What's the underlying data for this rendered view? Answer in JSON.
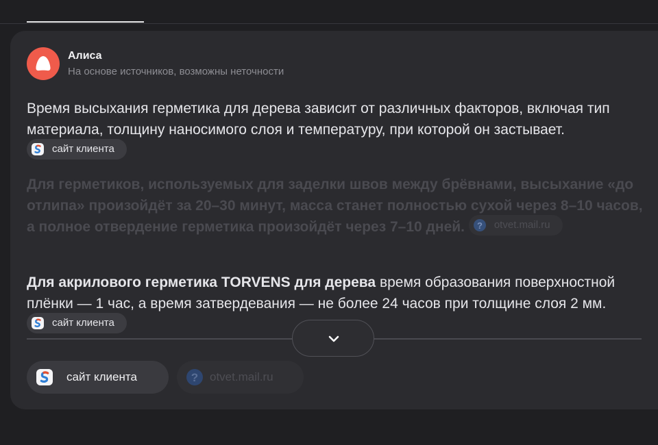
{
  "header": {
    "author": "Алиса",
    "disclaimer": "На основе источников, возможны неточности"
  },
  "answer": {
    "p1": "Время высыхания герметика для дерева зависит от различных факторов, включая тип материала, толщину наносимого слоя и температуру, при которой он застывает.",
    "p1_chip": "сайт клиента",
    "p2": "Для герметиков, используемых для заделки швов между брёвнами, высыхание «до отлипа» произойдёт за 20–30 минут, масса станет полностью сухой через 8–10 часов, а полное отвердение герметика произойдёт через 7–10 дней.",
    "p2_chip": "otvet.mail.ru",
    "p3_bold": "Для акрилового герметика TORVENS для дерева",
    "p3_rest": " время образования поверхностной плёнки — 1 час, а время затвердевания — не более 24 часов при толщине слоя 2 мм.",
    "p3_chip": "сайт клиента"
  },
  "sources": [
    {
      "label": "сайт клиента",
      "icon": "client-site-icon"
    },
    {
      "label": "otvet.mail.ru",
      "icon": "question-icon"
    }
  ],
  "icons": {
    "expand": "chevron-down-icon",
    "avatar": "alice-logo-icon"
  },
  "colors": {
    "accent": "#ef5b4b",
    "background": "#1f1f22",
    "card": "#2b2b2f"
  }
}
